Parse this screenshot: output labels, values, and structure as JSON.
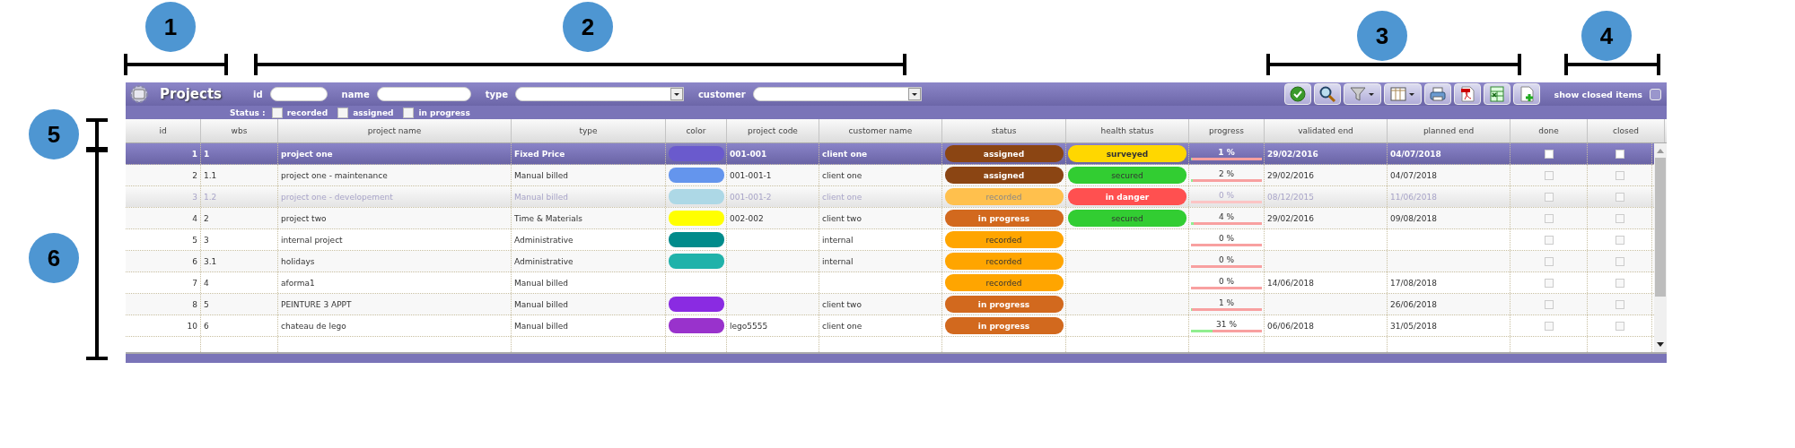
{
  "callouts": [
    {
      "number": "1",
      "kind": "top"
    },
    {
      "number": "2",
      "kind": "top"
    },
    {
      "number": "3",
      "kind": "top"
    },
    {
      "number": "4",
      "kind": "top"
    },
    {
      "number": "5",
      "kind": "side"
    },
    {
      "number": "6",
      "kind": "side"
    }
  ],
  "header": {
    "title": "Projects",
    "filters": [
      {
        "label": "id",
        "kind": "text"
      },
      {
        "label": "name",
        "kind": "text"
      },
      {
        "label": "type",
        "kind": "select"
      },
      {
        "label": "customer",
        "kind": "select"
      }
    ],
    "toolbar": [
      {
        "kind": "check"
      },
      {
        "kind": "search"
      },
      {
        "kind": "filter"
      },
      {
        "kind": "columns"
      },
      {
        "kind": "print"
      },
      {
        "kind": "pdf"
      },
      {
        "kind": "excel"
      },
      {
        "kind": "new"
      }
    ],
    "show_closed": {
      "label": "show closed items",
      "checked": false
    }
  },
  "status_filter": {
    "label": "Status :",
    "options": [
      {
        "label": "recorded",
        "checked": false
      },
      {
        "label": "assigned",
        "checked": false
      },
      {
        "label": "in progress",
        "checked": false
      }
    ]
  },
  "table": {
    "columns": [
      "id",
      "wbs",
      "project name",
      "type",
      "color",
      "project code",
      "customer name",
      "status",
      "health status",
      "progress",
      "validated end",
      "planned end",
      "done",
      "closed"
    ],
    "rows": [
      {
        "id": "1",
        "wbs": "1",
        "name": "project one",
        "type": "Fixed Price",
        "color": "#6a5acd",
        "code": "001-001",
        "customer": "client one",
        "status": {
          "label": "assigned",
          "color": "#8b4513"
        },
        "health": {
          "label": "surveyed",
          "color": "#ffd700"
        },
        "progress": "1 %",
        "level": 0.01,
        "validated_end": "29/02/2016",
        "planned_end": "04/07/2018",
        "done": false,
        "closed": false,
        "selected": true,
        "disabled": false
      },
      {
        "id": "2",
        "wbs": "1.1",
        "name": "project one - maintenance",
        "type": "Manual billed",
        "color": "#6495ed",
        "code": "001-001-1",
        "customer": "client one",
        "status": {
          "label": "assigned",
          "color": "#8b4513"
        },
        "health": {
          "label": "secured",
          "color": "#32cd32"
        },
        "progress": "2 %",
        "level": 0.02,
        "validated_end": "29/02/2016",
        "planned_end": "04/07/2018",
        "done": false,
        "closed": false,
        "selected": false,
        "disabled": false
      },
      {
        "id": "3",
        "wbs": "1.2",
        "name": "project one - developement",
        "type": "Manual billed",
        "color": "#add8e6",
        "code": "001-001-2",
        "customer": "client one",
        "status": {
          "label": "recorded",
          "color": "#ffc04d"
        },
        "health": {
          "label": "in danger",
          "color": "#ff5050"
        },
        "progress": "0 %",
        "level": 0,
        "validated_end": "08/12/2015",
        "planned_end": "11/06/2018",
        "done": false,
        "closed": false,
        "selected": false,
        "disabled": true
      },
      {
        "id": "4",
        "wbs": "2",
        "name": "project two",
        "type": "Time & Materials",
        "color": "#ffff00",
        "code": "002-002",
        "customer": "client two",
        "status": {
          "label": "in progress",
          "color": "#d2691e"
        },
        "health": {
          "label": "secured",
          "color": "#32cd32"
        },
        "progress": "4 %",
        "level": 0.04,
        "validated_end": "29/02/2016",
        "planned_end": "09/08/2018",
        "done": false,
        "closed": false,
        "selected": false,
        "disabled": false
      },
      {
        "id": "5",
        "wbs": "3",
        "name": "internal project",
        "type": "Administrative",
        "color": "#008b8b",
        "customer": "internal",
        "status": {
          "label": "recorded",
          "color": "#ffa500"
        },
        "progress": "0 %",
        "level": 0,
        "done": false,
        "closed": false,
        "selected": false,
        "disabled": false
      },
      {
        "id": "6",
        "wbs": "3.1",
        "name": "holidays",
        "type": "Administrative",
        "color": "#20b2aa",
        "customer": "internal",
        "status": {
          "label": "recorded",
          "color": "#ffa500"
        },
        "progress": "0 %",
        "level": 0,
        "done": false,
        "closed": false,
        "selected": false,
        "disabled": false
      },
      {
        "id": "7",
        "wbs": "4",
        "name": "aforma1",
        "type": "Manual billed",
        "status": {
          "label": "recorded",
          "color": "#ffa500"
        },
        "progress": "0 %",
        "level": 0,
        "validated_end": "14/06/2018",
        "planned_end": "17/08/2018",
        "done": false,
        "closed": false,
        "selected": false,
        "disabled": false
      },
      {
        "id": "8",
        "wbs": "5",
        "name": "PEINTURE 3 APPT",
        "type": "Manual billed",
        "color": "#8a2be2",
        "customer": "client two",
        "status": {
          "label": "in progress",
          "color": "#d2691e"
        },
        "progress": "1 %",
        "level": 0.01,
        "planned_end": "26/06/2018",
        "done": false,
        "closed": false,
        "selected": false,
        "disabled": false
      },
      {
        "id": "10",
        "wbs": "6",
        "name": "chateau de lego",
        "type": "Manual billed",
        "color": "#9932cc",
        "code": "lego5555",
        "customer": "client one",
        "status": {
          "label": "in progress",
          "color": "#d2691e"
        },
        "progress": "31 %",
        "level": 0.31,
        "validated_end": "06/06/2018",
        "planned_end": "31/05/2018",
        "done": false,
        "closed": false,
        "selected": false,
        "disabled": false
      }
    ]
  }
}
